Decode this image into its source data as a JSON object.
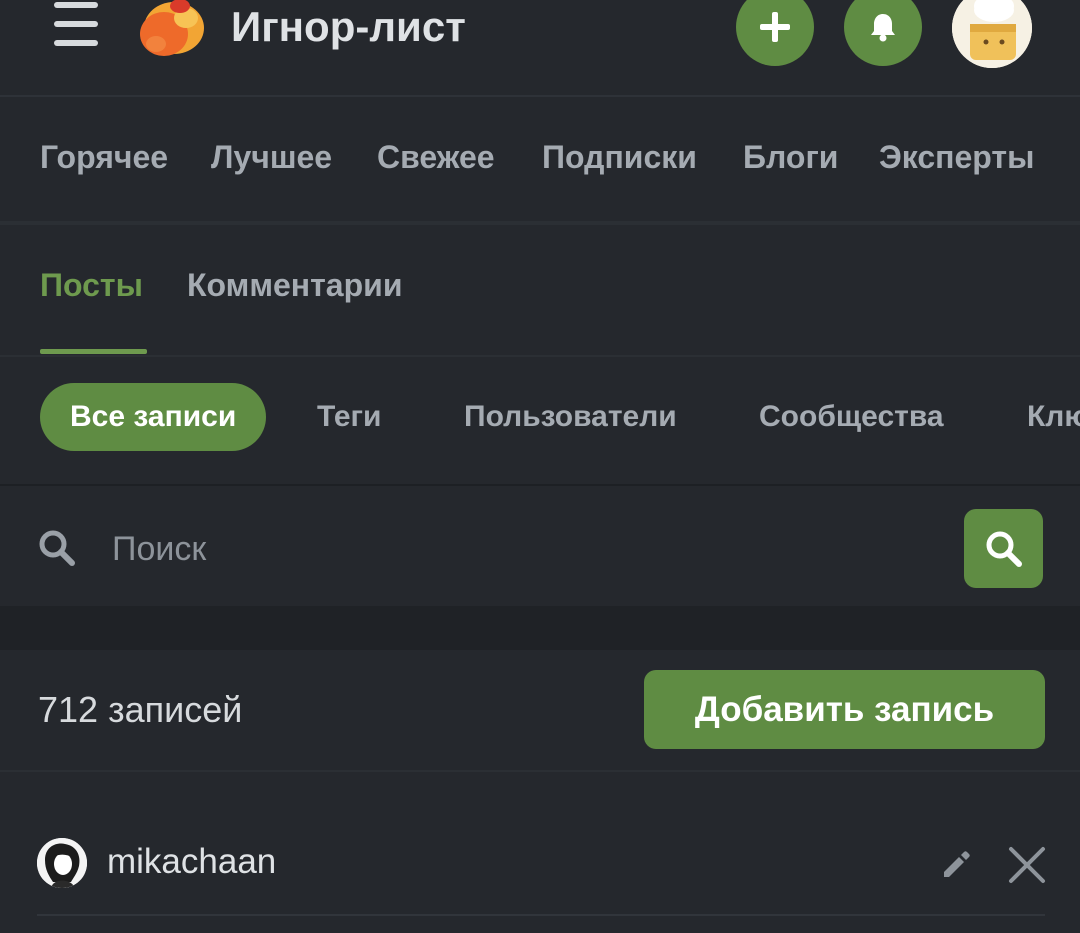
{
  "header": {
    "title": "Игнор-лист",
    "menu_icon": "hamburger-menu-icon",
    "logo_icon": "peekaboo-logo-icon",
    "add_icon": "plus-icon",
    "notifications_icon": "bell-icon",
    "profile_avatar_icon": "profile-avatar"
  },
  "main_nav": {
    "items": [
      "Горячее",
      "Лучшее",
      "Свежее",
      "Подписки",
      "Блоги",
      "Эксперты"
    ]
  },
  "tabs": {
    "items": [
      "Посты",
      "Комментарии"
    ],
    "active": "Посты"
  },
  "filters": {
    "items": [
      "Все записи",
      "Теги",
      "Пользователи",
      "Сообщества",
      "Клю"
    ],
    "active": "Все записи"
  },
  "search": {
    "placeholder": "Поиск",
    "value": ""
  },
  "list_header": {
    "count_text": "712 записей",
    "add_button_label": "Добавить запись"
  },
  "entries": [
    {
      "username": "mikachaan",
      "avatar_icon": "user-avatar",
      "edit_icon": "pencil-icon",
      "remove_icon": "close-icon"
    }
  ],
  "colors": {
    "background": "#25282d",
    "accent_green": "#5f8c43",
    "active_tab_green": "#6e9a4e",
    "muted_text": "#a5abb2",
    "primary_text": "#dfe2e5"
  }
}
